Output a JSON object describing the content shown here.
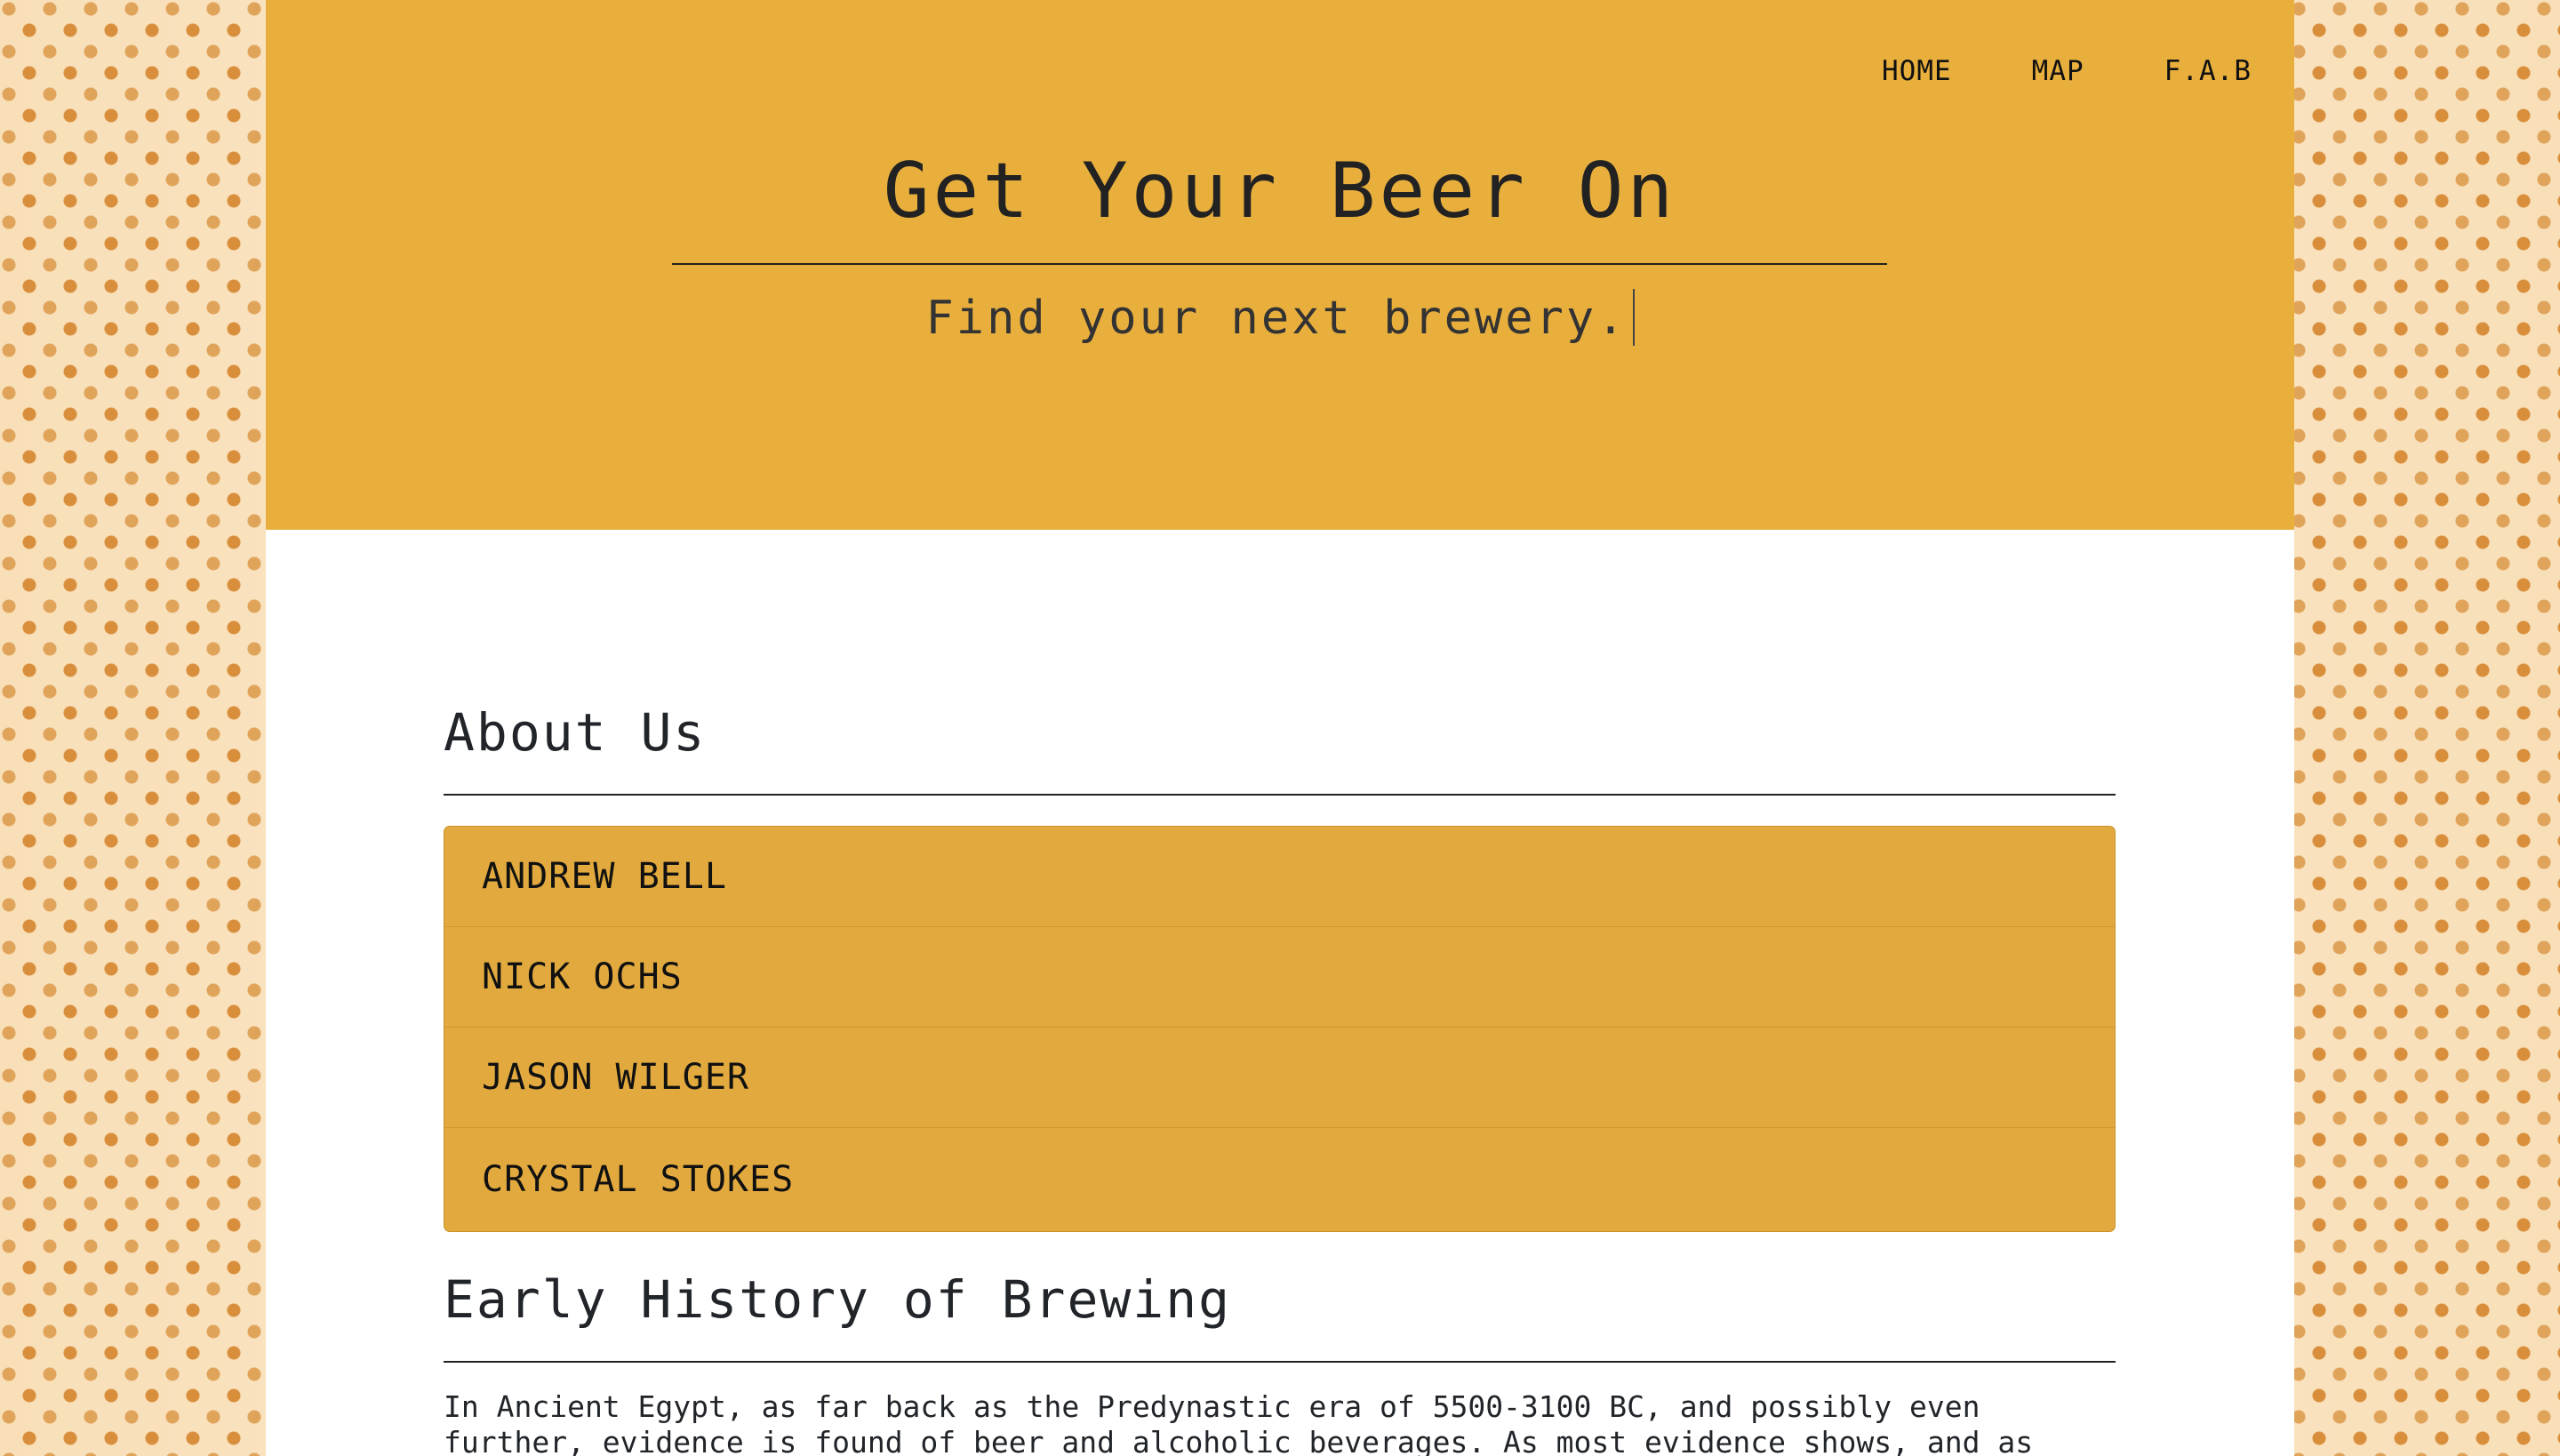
{
  "nav": {
    "items": [
      "HOME",
      "MAP",
      "F.A.B"
    ]
  },
  "hero": {
    "title": "Get Your Beer On",
    "subtitle": "Find your next brewery."
  },
  "about": {
    "title": "About Us",
    "members": [
      "ANDREW BELL",
      "NICK OCHS",
      "JASON WILGER",
      "CRYSTAL STOKES"
    ]
  },
  "history": {
    "title": "Early History of Brewing",
    "paragraph": "In Ancient Egypt, as far back as the Predynastic era of 5500-3100 BC, and possibly even further, evidence is found of beer and alcoholic beverages. As most evidence shows, and as recorded by the"
  },
  "colors": {
    "hero_background": "#e9af3d",
    "list_background": "#e2aa3e",
    "page_background": "#ffffff",
    "side_pattern": "#fbe6c6"
  },
  "icons": {
    "background_pattern": "beer-mug-icon"
  }
}
